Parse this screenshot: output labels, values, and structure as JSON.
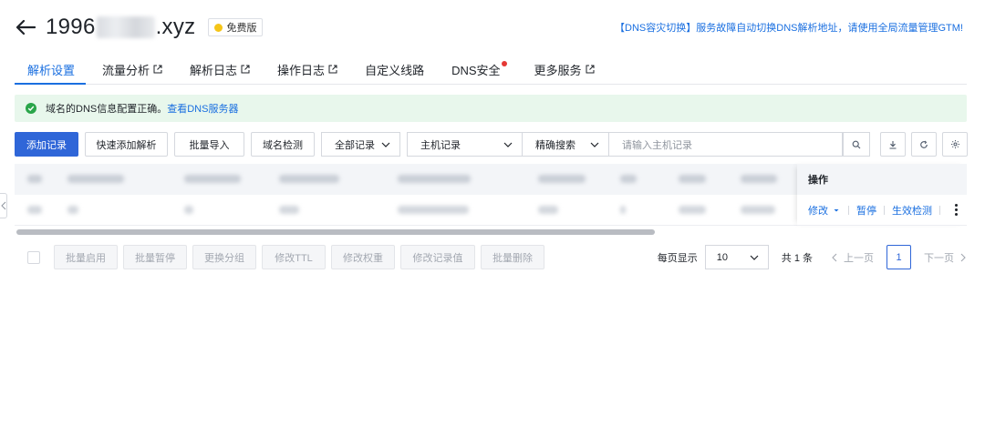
{
  "header": {
    "domain_prefix": "1996",
    "domain_suffix": ".xyz",
    "plan_badge": "免费版"
  },
  "top_notice": "【DNS容灾切换】服务故障自动切换DNS解析地址，请使用全局流量管理GTM!",
  "tabs": [
    {
      "label": "解析设置"
    },
    {
      "label": "流量分析"
    },
    {
      "label": "解析日志"
    },
    {
      "label": "操作日志"
    },
    {
      "label": "自定义线路"
    },
    {
      "label": "DNS安全"
    },
    {
      "label": "更多服务"
    }
  ],
  "alert": {
    "text": "域名的DNS信息配置正确。",
    "link": "查看DNS服务器"
  },
  "toolbar": {
    "add_record": "添加记录",
    "quick_add": "快速添加解析",
    "batch_import": "批量导入",
    "domain_check": "域名检测",
    "record_filter": "全部记录",
    "field_select": "主机记录",
    "match_mode": "精确搜索",
    "search_placeholder": "请输入主机记录"
  },
  "table": {
    "operation_header": "操作",
    "row_actions": {
      "modify": "修改",
      "pause": "暂停",
      "effect_check": "生效检测"
    }
  },
  "footer": {
    "batch_enable": "批量启用",
    "batch_pause": "批量暂停",
    "change_group": "更换分组",
    "modify_ttl": "修改TTL",
    "modify_weight": "修改权重",
    "modify_value": "修改记录值",
    "batch_delete": "批量删除"
  },
  "pager": {
    "per_page_label": "每页显示",
    "page_size": "10",
    "total": "共 1 条",
    "prev": "上一页",
    "current_page": "1",
    "next": "下一页"
  },
  "colors": {
    "primary": "#2f66d8",
    "link": "#1a6fe0",
    "success_bg": "#e8f7ec",
    "success": "#2aa54a"
  }
}
